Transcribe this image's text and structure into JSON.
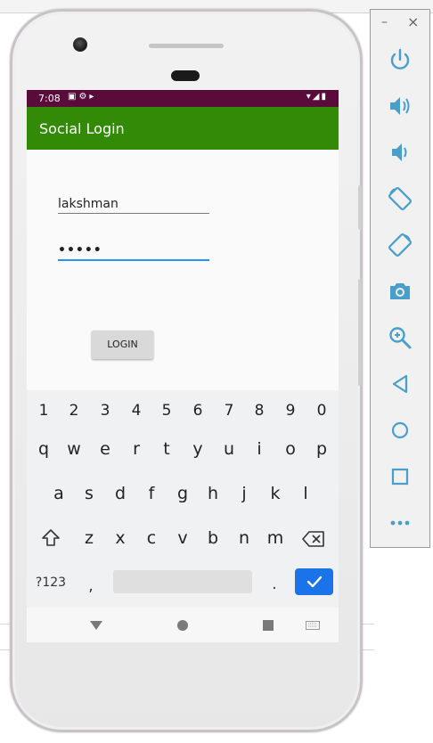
{
  "statusbar": {
    "time": "7:08"
  },
  "app": {
    "title": "Social Login"
  },
  "form": {
    "username_value": "lakshman",
    "password_value": "•••••",
    "login_label": "LOGIN"
  },
  "keyboard": {
    "numbers": [
      "1",
      "2",
      "3",
      "4",
      "5",
      "6",
      "7",
      "8",
      "9",
      "0"
    ],
    "row1": [
      "q",
      "w",
      "e",
      "r",
      "t",
      "y",
      "u",
      "i",
      "o",
      "p"
    ],
    "row2": [
      "a",
      "s",
      "d",
      "f",
      "g",
      "h",
      "j",
      "k",
      "l"
    ],
    "row3": [
      "z",
      "x",
      "c",
      "v",
      "b",
      "n",
      "m"
    ],
    "sym_label": "?123",
    "comma": ",",
    "period": "."
  },
  "panel": {
    "minimize": "–",
    "close": "×"
  },
  "colors": {
    "statusbar": "#5a0b3a",
    "appbar": "#338a07",
    "accent": "#2196f3",
    "enter": "#1a73e8",
    "panel_icon": "#4a9ecb"
  }
}
